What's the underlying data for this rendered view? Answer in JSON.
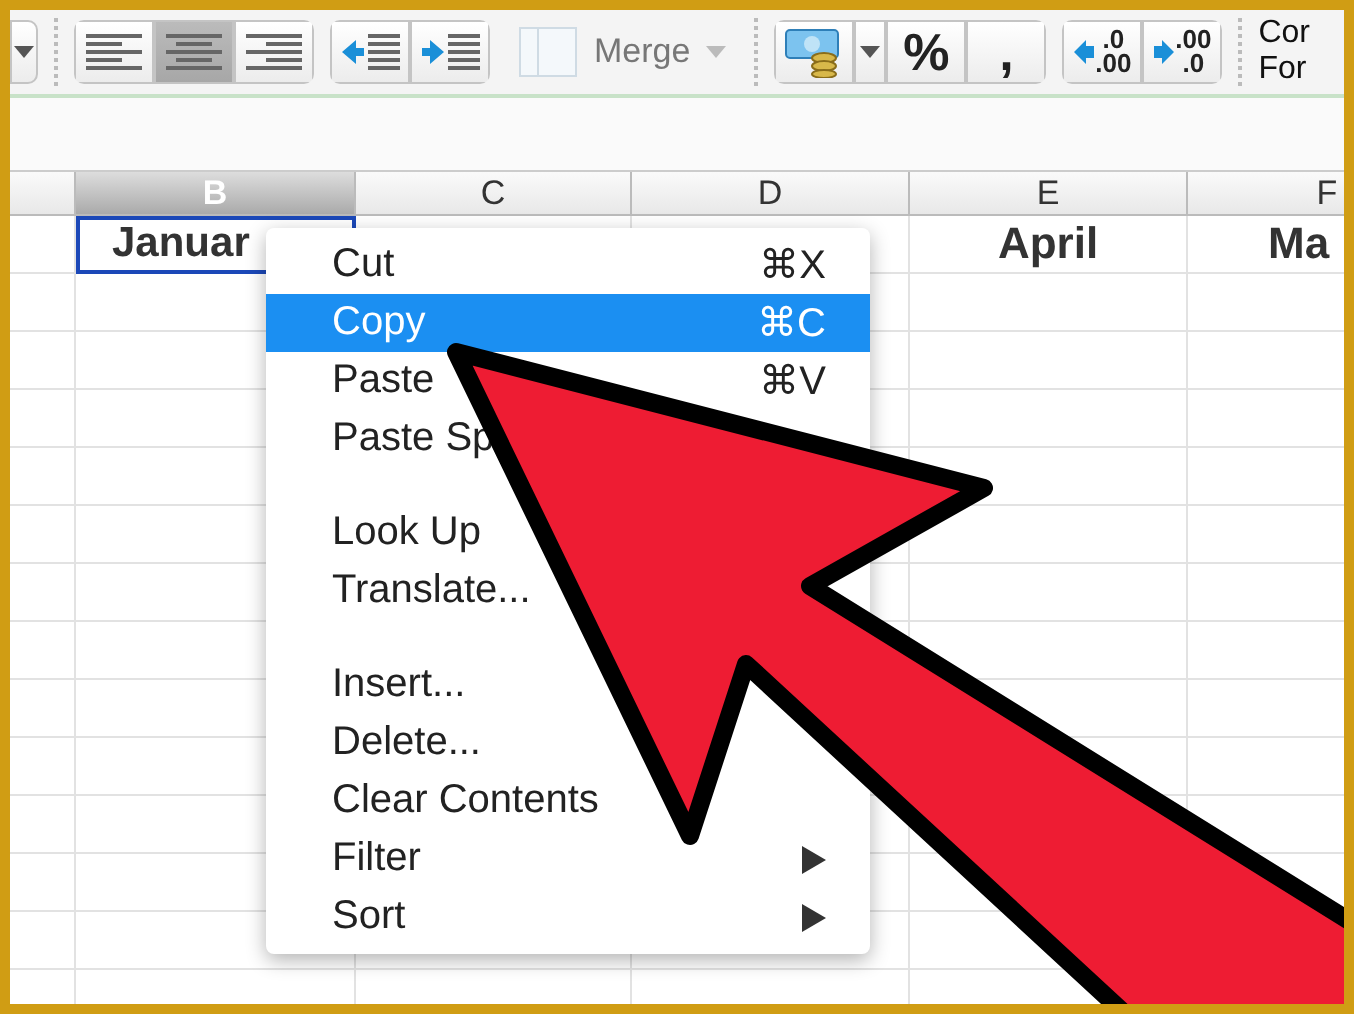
{
  "toolbar": {
    "alignment": [
      {
        "kind": "left",
        "selected": false
      },
      {
        "kind": "center",
        "selected": true
      },
      {
        "kind": "right",
        "selected": false
      }
    ],
    "merge": {
      "label": "Merge",
      "disabled": true
    },
    "percent": "%",
    "comma": ",",
    "decimals": [
      {
        "kind": "increase",
        "top": ".0",
        "bottom": ".00"
      },
      {
        "kind": "decrease",
        "top": ".00",
        "bottom": ".0"
      }
    ],
    "cut_button": [
      "Cor",
      "For"
    ]
  },
  "sheet": {
    "columns": [
      {
        "label": "B",
        "selected": true,
        "header": "Januar"
      },
      {
        "label": "C",
        "selected": false
      },
      {
        "label": "D",
        "selected": false
      },
      {
        "label": "E",
        "selected": false,
        "header": "April"
      },
      {
        "label": "F",
        "selected": false,
        "header": "Ma"
      }
    ]
  },
  "context_menu": {
    "groups": [
      [
        {
          "label": "Cut",
          "shortcut": "⌘X",
          "selected": false
        },
        {
          "label": "Copy",
          "shortcut": "⌘C",
          "selected": true
        },
        {
          "label": "Paste",
          "shortcut": "⌘V",
          "selected": false
        },
        {
          "label": "Paste Sp",
          "selected": false
        }
      ],
      [
        {
          "label": "Look Up",
          "selected": false
        },
        {
          "label": "Translate...",
          "selected": false
        }
      ],
      [
        {
          "label": "Insert...",
          "selected": false
        },
        {
          "label": "Delete...",
          "selected": false
        },
        {
          "label": "Clear Contents",
          "selected": false
        },
        {
          "label": "Filter",
          "submenu": true,
          "selected": false
        },
        {
          "label": "Sort",
          "submenu": true,
          "selected": false
        }
      ]
    ]
  }
}
